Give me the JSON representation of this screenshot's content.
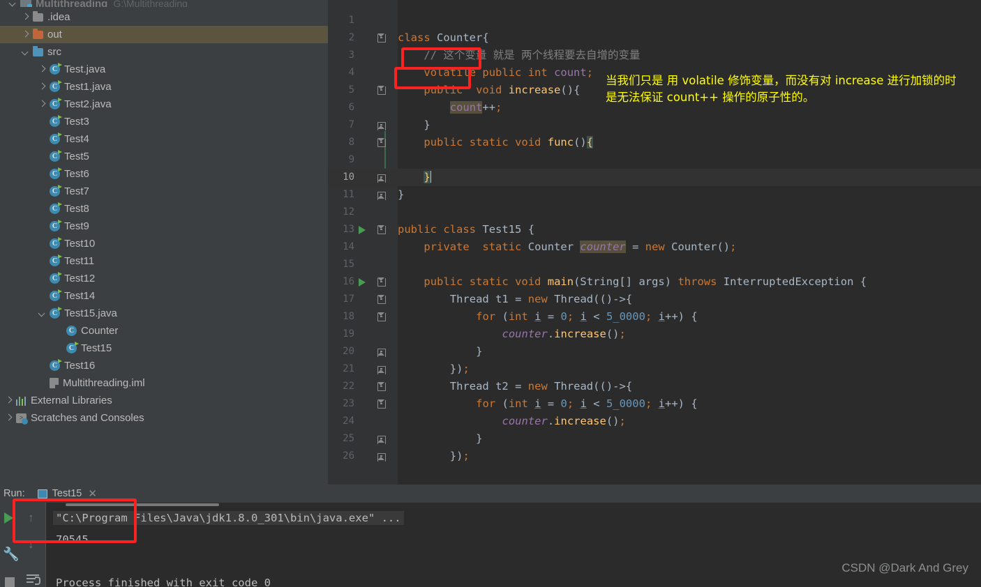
{
  "project": {
    "name": "Multithreading",
    "path": "G:\\Multithreading",
    "tree": [
      {
        "label": ".idea",
        "icon": "folder-grey-icon",
        "arrow": "right",
        "depth": 1
      },
      {
        "label": "out",
        "icon": "folder-orange-icon",
        "arrow": "right",
        "depth": 1,
        "selected": true
      },
      {
        "label": "src",
        "icon": "folder-blue-icon",
        "arrow": "down",
        "depth": 1
      },
      {
        "label": "Test.java",
        "icon": "java-class-icon",
        "arrow": "right",
        "depth": 2
      },
      {
        "label": "Test1.java",
        "icon": "java-class-icon",
        "arrow": "right",
        "depth": 2
      },
      {
        "label": "Test2.java",
        "icon": "java-class-icon",
        "arrow": "right",
        "depth": 2
      },
      {
        "label": "Test3",
        "icon": "java-class-icon",
        "arrow": "",
        "depth": 2
      },
      {
        "label": "Test4",
        "icon": "java-class-icon",
        "arrow": "",
        "depth": 2
      },
      {
        "label": "Test5",
        "icon": "java-class-icon",
        "arrow": "",
        "depth": 2
      },
      {
        "label": "Test6",
        "icon": "java-class-icon",
        "arrow": "",
        "depth": 2
      },
      {
        "label": "Test7",
        "icon": "java-class-icon",
        "arrow": "",
        "depth": 2
      },
      {
        "label": "Test8",
        "icon": "java-class-icon",
        "arrow": "",
        "depth": 2
      },
      {
        "label": "Test9",
        "icon": "java-class-icon",
        "arrow": "",
        "depth": 2
      },
      {
        "label": "Test10",
        "icon": "java-class-icon",
        "arrow": "",
        "depth": 2
      },
      {
        "label": "Test11",
        "icon": "java-class-icon",
        "arrow": "",
        "depth": 2
      },
      {
        "label": "Test12",
        "icon": "java-class-icon",
        "arrow": "",
        "depth": 2
      },
      {
        "label": "Test14",
        "icon": "java-class-icon",
        "arrow": "",
        "depth": 2
      },
      {
        "label": "Test15.java",
        "icon": "java-class-icon",
        "arrow": "down",
        "depth": 2
      },
      {
        "label": "Counter",
        "icon": "class-icon",
        "arrow": "",
        "depth": 3
      },
      {
        "label": "Test15",
        "icon": "java-class-icon",
        "arrow": "",
        "depth": 3
      },
      {
        "label": "Test16",
        "icon": "java-class-icon",
        "arrow": "",
        "depth": 2
      },
      {
        "label": "Multithreading.iml",
        "icon": "iml-icon",
        "arrow": "",
        "depth": 2
      },
      {
        "label": "External Libraries",
        "icon": "library-icon",
        "arrow": "right",
        "depth": 0
      },
      {
        "label": "Scratches and Consoles",
        "icon": "scratch-icon",
        "arrow": "right",
        "depth": 0
      }
    ]
  },
  "editor": {
    "current_line": 10,
    "lines": [
      {
        "n": 1,
        "text": ""
      },
      {
        "n": 2,
        "text": "class Counter{"
      },
      {
        "n": 3,
        "text": "    // 这个变量 就是 两个线程要去自增的变量"
      },
      {
        "n": 4,
        "text": "    volatile public int count;"
      },
      {
        "n": 5,
        "text": "    public  void increase(){"
      },
      {
        "n": 6,
        "text": "        count++;"
      },
      {
        "n": 7,
        "text": "    }"
      },
      {
        "n": 8,
        "text": "    public static void func(){"
      },
      {
        "n": 9,
        "text": ""
      },
      {
        "n": 10,
        "text": "    }"
      },
      {
        "n": 11,
        "text": "}"
      },
      {
        "n": 12,
        "text": ""
      },
      {
        "n": 13,
        "text": "public class Test15 {"
      },
      {
        "n": 14,
        "text": "    private  static Counter counter = new Counter();"
      },
      {
        "n": 15,
        "text": ""
      },
      {
        "n": 16,
        "text": "    public static void main(String[] args) throws InterruptedException {"
      },
      {
        "n": 17,
        "text": "        Thread t1 = new Thread(()->{"
      },
      {
        "n": 18,
        "text": "            for (int i = 0; i < 5_0000; i++) {"
      },
      {
        "n": 19,
        "text": "                counter.increase();"
      },
      {
        "n": 20,
        "text": "            }"
      },
      {
        "n": 21,
        "text": "        });"
      },
      {
        "n": 22,
        "text": "        Thread t2 = new Thread(()->{"
      },
      {
        "n": 23,
        "text": "            for (int i = 0; i < 5_0000; i++) {"
      },
      {
        "n": 24,
        "text": "                counter.increase();"
      },
      {
        "n": 25,
        "text": "            }"
      },
      {
        "n": 26,
        "text": "        });"
      }
    ],
    "annotations": {
      "box_volatile_label": "volatile",
      "box_public_label": "public",
      "note_line1": "当我们只是 用 volatile 修饰变量，而没有对 increase 进行加锁的时",
      "note_line2": "是无法保证 count++ 操作的原子性的。",
      "box_color": "#fb2222",
      "note_color": "#ffff00"
    }
  },
  "run_panel": {
    "label": "Run:",
    "tab_name": "Test15",
    "close_glyph": "✕",
    "console": [
      "\"C:\\Program Files\\Java\\jdk1.8.0_301\\bin\\java.exe\" ...",
      "70545",
      "Process finished with exit code 0"
    ],
    "toolbar": {
      "run_icon": "play-icon",
      "settings_icon": "wrench-icon",
      "stop_icon": "stop-icon",
      "up_icon": "arrow-up-icon",
      "down_icon": "arrow-down-icon",
      "wrap_icon": "soft-wrap-icon",
      "up_glyph": "↑",
      "down_glyph": "↓"
    }
  },
  "watermark": "CSDN @Dark And Grey"
}
